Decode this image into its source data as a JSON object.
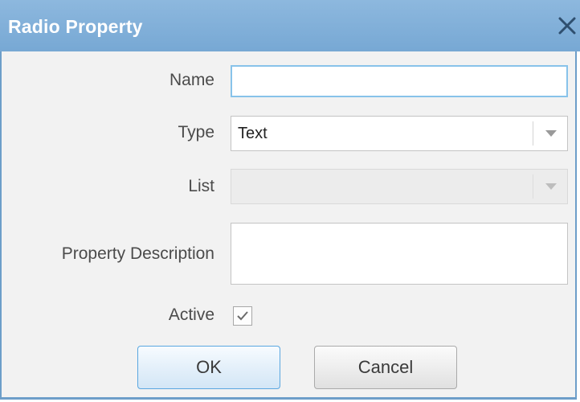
{
  "dialog": {
    "title": "Radio Property",
    "close_icon": "close-x-icon"
  },
  "form": {
    "name_label": "Name",
    "name_value": "",
    "type_label": "Type",
    "type_value": "Text",
    "list_label": "List",
    "list_value": "",
    "description_label": "Property Description",
    "description_value": "",
    "active_label": "Active",
    "active_checked": true
  },
  "buttons": {
    "ok_label": "OK",
    "cancel_label": "Cancel"
  },
  "colors": {
    "titlebar": "#7fafd9",
    "focus_border": "#88c3ea",
    "ok_border": "#5aa7e0"
  }
}
